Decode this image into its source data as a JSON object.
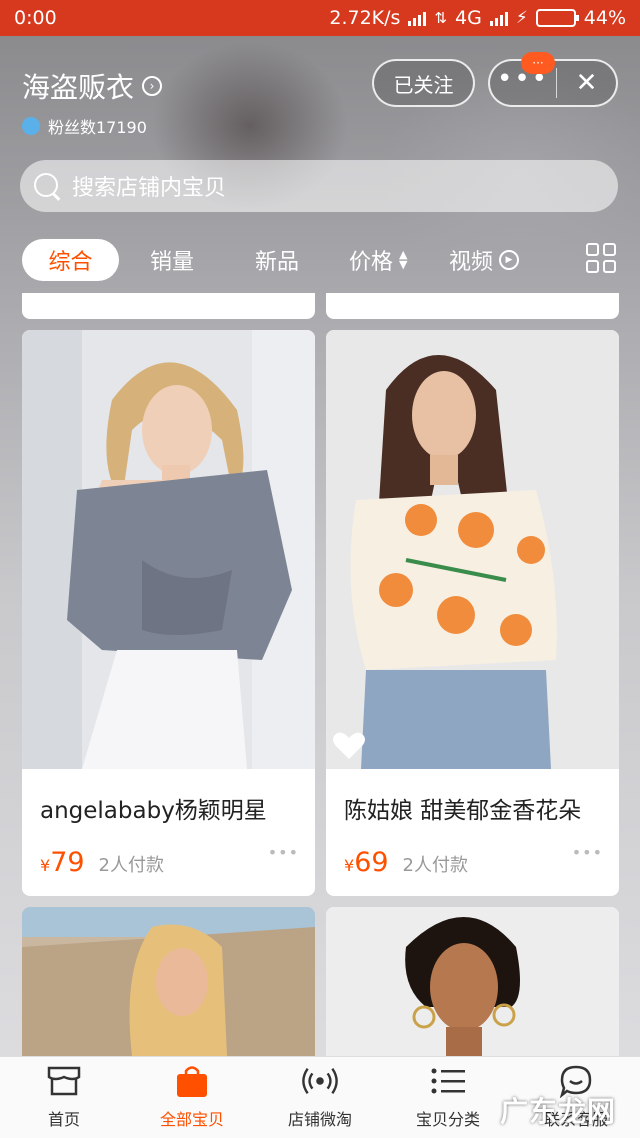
{
  "status_bar": {
    "time": "0:00",
    "network_speed": "2.72K/s",
    "network_type": "4G",
    "battery": "44%",
    "battery_level": 0.44
  },
  "store": {
    "name": "海盗贩衣",
    "fans_label": "粉丝数17190",
    "follow_label": "已关注",
    "more_badge": "···",
    "close_label": "✕"
  },
  "search": {
    "placeholder": "搜索店铺内宝贝"
  },
  "filter_tabs": {
    "comprehensive": "综合",
    "sales": "销量",
    "new": "新品",
    "price": "价格",
    "video": "视频"
  },
  "products": [
    {
      "title": "angelababy杨颖明星",
      "currency": "¥",
      "price": "79",
      "paid": "2人付款"
    },
    {
      "title": "陈姑娘 甜美郁金香花朵",
      "currency": "¥",
      "price": "69",
      "paid": "2人付款"
    }
  ],
  "bottom_nav": {
    "home": "首页",
    "all_items": "全部宝贝",
    "store_weitao": "店铺微淘",
    "categories": "宝贝分类",
    "contact_service": "联系客服"
  },
  "watermark": "广东龙网",
  "colors": {
    "status_bar": "#d6391d",
    "accent": "#ff5000",
    "inactive_text": "#999999"
  }
}
